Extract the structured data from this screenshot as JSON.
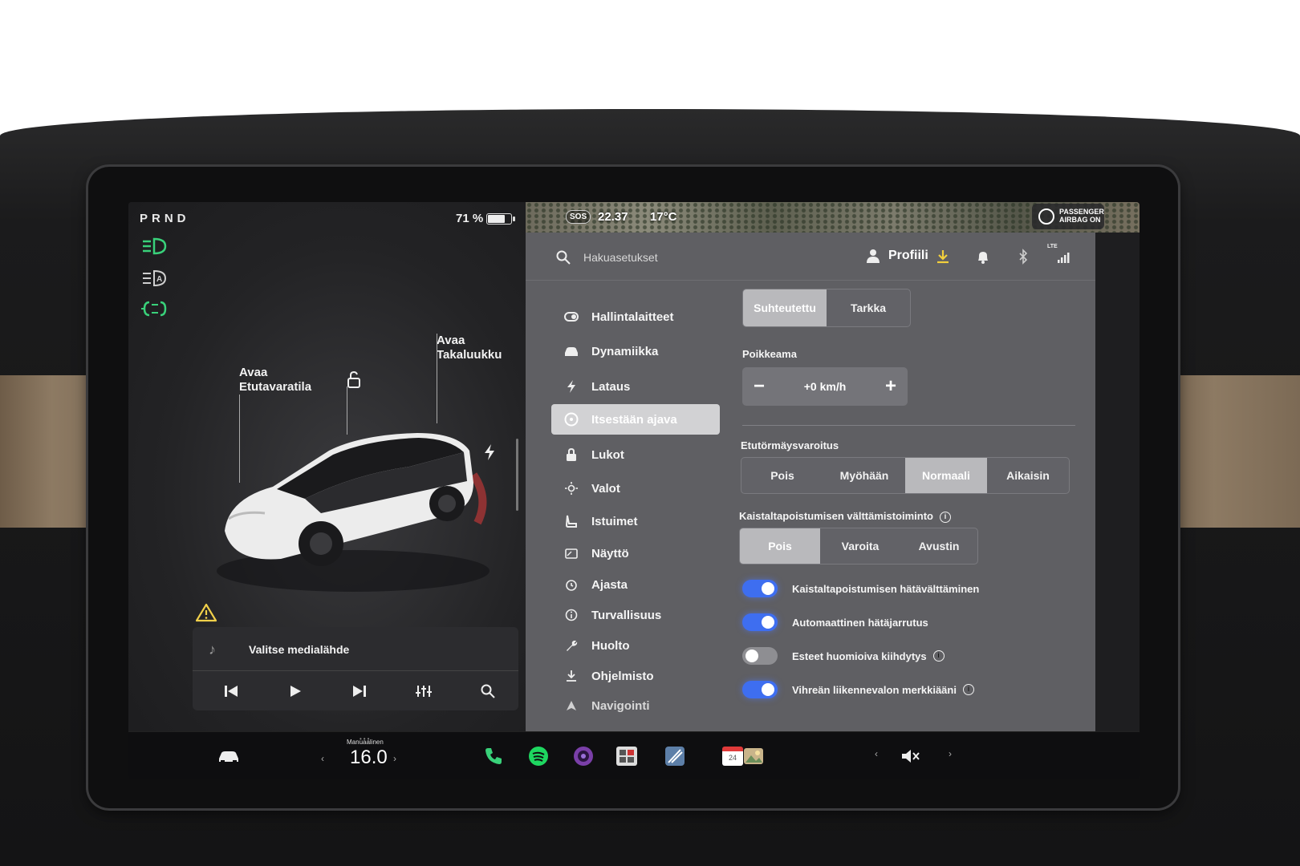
{
  "left": {
    "gear": "PRND",
    "battery_pct": "71 %",
    "callout_frunk": [
      "Avaa",
      "Etutavaratila"
    ],
    "callout_trunk": [
      "Avaa",
      "Takaluukku"
    ],
    "media_source": "Valitse medialähde"
  },
  "status": {
    "time": "22.37",
    "temp": "17°C",
    "sos": "SOS",
    "airbag": [
      "PASSENGER",
      "AIRBAG ON"
    ]
  },
  "topbar": {
    "search_placeholder": "Hakuasetukset",
    "profile": "Profiili",
    "lte": "LTE"
  },
  "nav": {
    "items": [
      {
        "label": "Hallintalaitteet",
        "icon": "toggle-icon"
      },
      {
        "label": "Dynamiikka",
        "icon": "car-icon"
      },
      {
        "label": "Lataus",
        "icon": "bolt-icon"
      },
      {
        "label": "Itsestään ajava",
        "icon": "steering-wheel-icon",
        "active": true
      },
      {
        "label": "Lukot",
        "icon": "lock-icon"
      },
      {
        "label": "Valot",
        "icon": "sun-icon"
      },
      {
        "label": "Istuimet",
        "icon": "seat-icon"
      },
      {
        "label": "Näyttö",
        "icon": "display-icon"
      },
      {
        "label": "Ajasta",
        "icon": "alarm-icon"
      },
      {
        "label": "Turvallisuus",
        "icon": "info-icon"
      },
      {
        "label": "Huolto",
        "icon": "wrench-icon"
      },
      {
        "label": "Ohjelmisto",
        "icon": "download-icon"
      },
      {
        "label": "Navigointi",
        "icon": "navigation-icon"
      }
    ]
  },
  "content": {
    "speed_mode": {
      "options": [
        "Suhteutettu",
        "Tarkka"
      ],
      "selected": "Suhteutettu"
    },
    "offset_label": "Poikkeama",
    "offset_minus": "−",
    "offset_value": "+0 km/h",
    "offset_plus": "+",
    "fcw_label": "Etutörmäysvaroitus",
    "fcw": {
      "options": [
        "Pois",
        "Myöhään",
        "Normaali",
        "Aikaisin"
      ],
      "selected": "Normaali"
    },
    "lda_label": "Kaistaltapoistumisen välttämistoiminto",
    "lda": {
      "options": [
        "Pois",
        "Varoita",
        "Avustin"
      ],
      "selected": "Pois"
    },
    "toggles": [
      {
        "label": "Kaistaltapoistumisen hätävälttäminen",
        "on": true,
        "info": false
      },
      {
        "label": "Automaattinen hätäjarrutus",
        "on": true,
        "info": false
      },
      {
        "label": "Esteet huomioiva kiihdytys",
        "on": false,
        "info": true
      },
      {
        "label": "Vihreän liikennevalon merkkiääni",
        "on": true,
        "info": true
      }
    ],
    "info_glyph": "i"
  },
  "taskbar": {
    "climate_mode": "Manuaalinen",
    "climate_temp": "16.0",
    "calendar_day": "24"
  },
  "colors": {
    "accent_toggle": "#3e6ef0",
    "indicator_green": "#39d17a",
    "charge_red": "#e03a3a"
  }
}
